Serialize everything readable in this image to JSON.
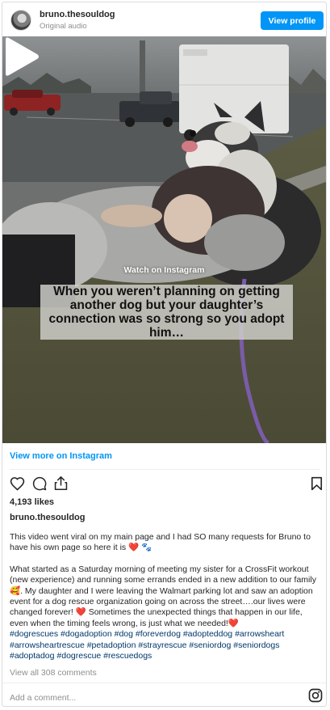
{
  "header": {
    "username": "bruno.thesouldog",
    "subtitle": "Original audio",
    "view_profile_label": "View profile"
  },
  "media": {
    "overlay_text": "When you weren’t planning on getting another dog but your daughter’s connection was so strong so you adopt him…",
    "watch_label": "Watch on Instagram"
  },
  "post": {
    "view_more_label": "View more on Instagram",
    "likes": "4,193 likes",
    "username": "bruno.thesouldog",
    "caption_p1": "This video went viral on my main page and I had SO many requests for Bruno to have his own page so here it is ❤️ 🐾",
    "caption_p2": "What started as a Saturday morning of meeting my sister for a CrossFit workout (new experience) and running some errands ended in a new addition to our family🥰. My daughter and I were leaving the Walmart parking lot and saw an adoption event for a dog rescue organization going on across the street….our lives were changed forever! ❤️ Sometimes the unexpected things that happen in our life, even when the timing feels wrong, is just what we needed!❤️",
    "hashtags": "#dogrescues #dogadoption #dog #foreverdog #adopteddog #arrowsheart #arrowsheartrescue #petadoption #strayrescue #seniordog #seniordogs #adoptadog #dogrescue #rescuedogs",
    "view_comments_label": "View all 308 comments",
    "add_comment_placeholder": "Add a comment..."
  },
  "icons": {
    "like": "heart-icon",
    "comment": "comment-icon",
    "share": "share-icon",
    "save": "bookmark-icon",
    "brand": "instagram-icon"
  },
  "colors": {
    "accent": "#0095f6",
    "hashtag": "#00376b",
    "muted": "#8e8e8e"
  }
}
